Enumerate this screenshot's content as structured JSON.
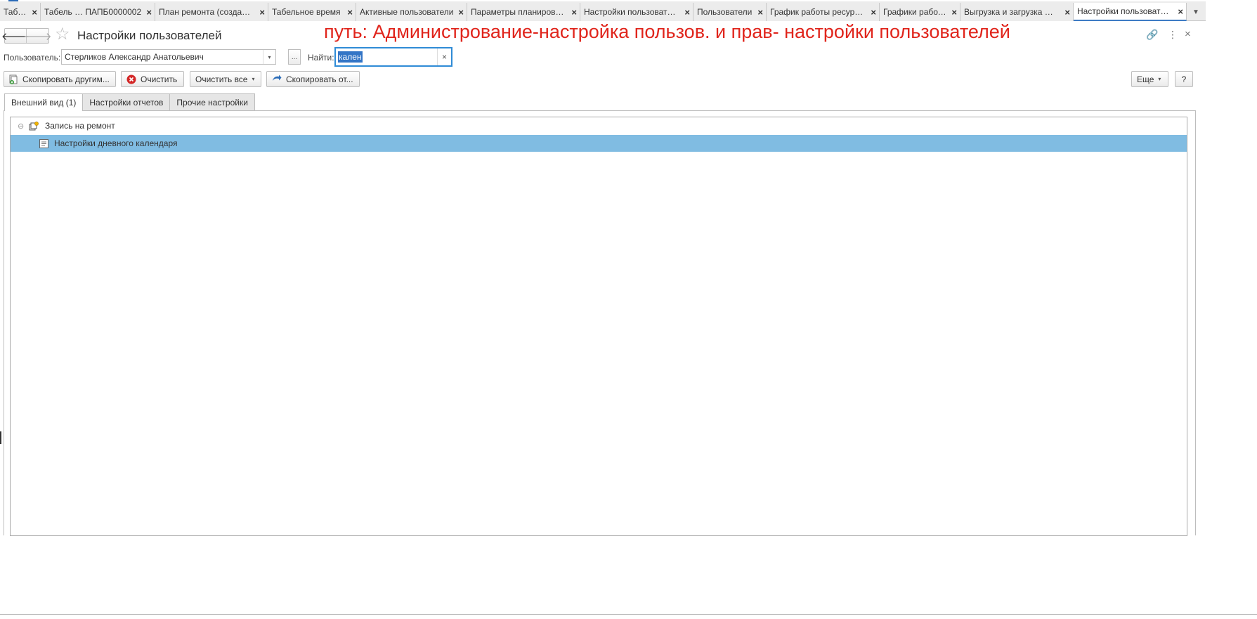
{
  "tabs": [
    {
      "label": "Табель",
      "active": false
    },
    {
      "label": "Табель … ПАПБ0000002",
      "active": false
    },
    {
      "label": "План ремонта (созда…",
      "active": false
    },
    {
      "label": "Табельное время",
      "active": false
    },
    {
      "label": "Активные пользователи",
      "active": false
    },
    {
      "label": "Параметры планиров…",
      "active": false
    },
    {
      "label": "Настройки пользоват…",
      "active": false
    },
    {
      "label": "Пользователи",
      "active": false
    },
    {
      "label": "График работы ресур…",
      "active": false
    },
    {
      "label": "Графики работы",
      "active": false
    },
    {
      "label": "Выгрузка и загрузка …",
      "active": false
    },
    {
      "label": "Настройки пользоват…",
      "active": true
    }
  ],
  "tab_close_glyph": "×",
  "tab_more_glyph": "▼",
  "header": {
    "back_glyph": "🡐",
    "forward_glyph": "🡒",
    "star_glyph": "☆",
    "title": "Настройки пользователей",
    "annotation": "путь: Администрование-настройка пользов. и прав- настройки пользователей",
    "link_glyph": "🔗",
    "more_glyph": "⋮",
    "close_glyph": "×"
  },
  "filters": {
    "user_label": "Пользователь:",
    "user_value": "Стерликов Александр Анатольевич",
    "dropdown_glyph": "▾",
    "select_glyph": "...",
    "search_label": "Найти:",
    "search_value": "кален",
    "clear_glyph": "×"
  },
  "toolbar": {
    "copy_to_others": "Скопировать другим...",
    "clear": "Очистить",
    "clear_all": "Очистить все",
    "copy_from": "Скопировать от...",
    "more": "Еще",
    "help": "?",
    "caret_glyph": "▾"
  },
  "inner_tabs": [
    {
      "label": "Внешний вид (1)",
      "active": true
    },
    {
      "label": "Настройки отчетов",
      "active": false
    },
    {
      "label": "Прочие настройки",
      "active": false
    }
  ],
  "tree": {
    "toggle_glyph": "⊖",
    "rows": [
      {
        "label": "Запись на ремонт",
        "level": 0,
        "selected": false
      },
      {
        "label": "Настройки дневного календаря",
        "level": 1,
        "selected": true
      }
    ]
  },
  "colors": {
    "annotation": "#e0251c",
    "selection": "#80bce2",
    "focus": "#2f8bd6",
    "active_tab_underline": "#3d7bc4"
  }
}
